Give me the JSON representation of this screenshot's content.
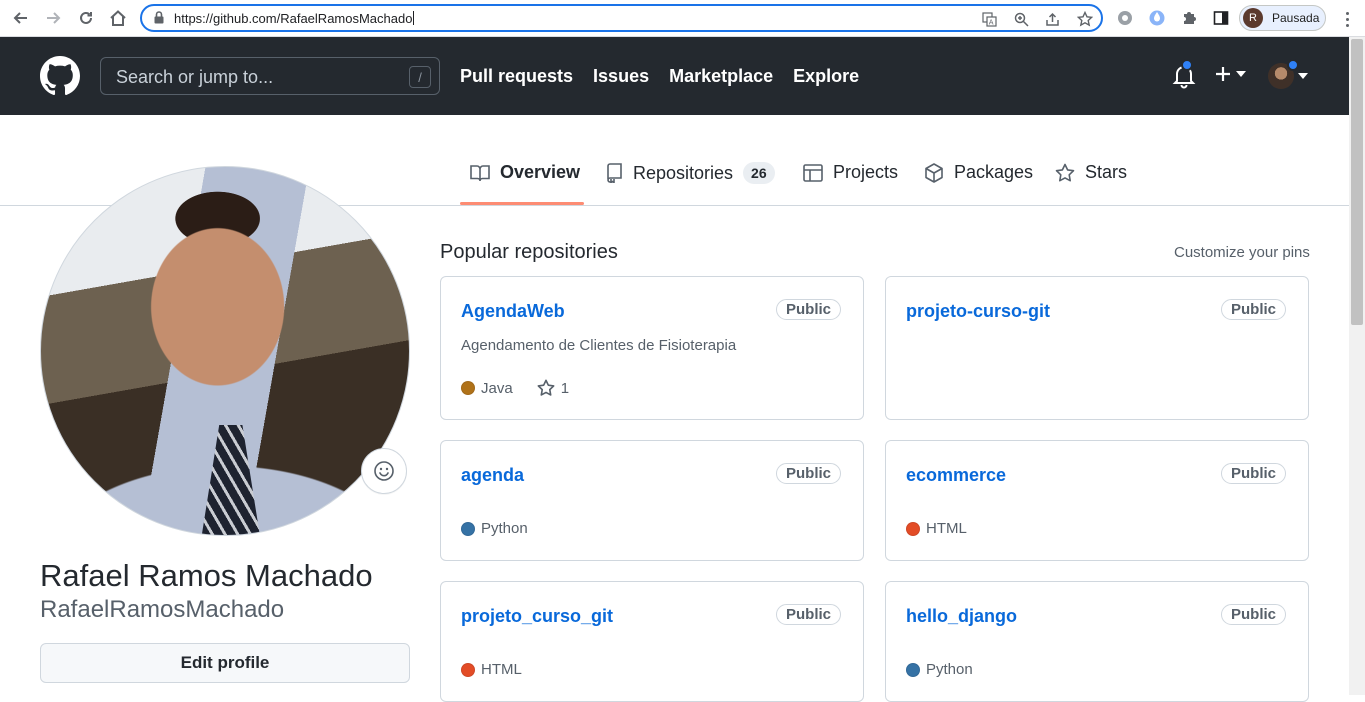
{
  "browser": {
    "url": "https://github.com/RafaelRamosMachado",
    "profile_initial": "R",
    "profile_status": "Pausada"
  },
  "header": {
    "search_placeholder": "Search or jump to...",
    "search_shortcut": "/",
    "nav": [
      "Pull requests",
      "Issues",
      "Marketplace",
      "Explore"
    ]
  },
  "tabs": [
    {
      "label": "Overview",
      "icon": "book-icon",
      "selected": true
    },
    {
      "label": "Repositories",
      "icon": "repo-icon",
      "count": "26"
    },
    {
      "label": "Projects",
      "icon": "table-icon"
    },
    {
      "label": "Packages",
      "icon": "package-icon"
    },
    {
      "label": "Stars",
      "icon": "star-icon"
    }
  ],
  "profile": {
    "full_name": "Rafael Ramos Machado",
    "username": "RafaelRamosMachado",
    "edit_label": "Edit profile"
  },
  "popular": {
    "title": "Popular repositories",
    "customize_label": "Customize your pins",
    "repos": [
      {
        "name": "AgendaWeb",
        "visibility": "Public",
        "description": "Agendamento de Clientes de Fisioterapia",
        "language": "Java",
        "lang_color": "#b07219",
        "stars": "1"
      },
      {
        "name": "projeto-curso-git",
        "visibility": "Public"
      },
      {
        "name": "agenda",
        "visibility": "Public",
        "language": "Python",
        "lang_color": "#3572a5"
      },
      {
        "name": "ecommerce",
        "visibility": "Public",
        "language": "HTML",
        "lang_color": "#e34c26"
      },
      {
        "name": "projeto_curso_git",
        "visibility": "Public",
        "language": "HTML",
        "lang_color": "#e34c26"
      },
      {
        "name": "hello_django",
        "visibility": "Public",
        "language": "Python",
        "lang_color": "#3572a5"
      }
    ]
  },
  "colors": {
    "header_bg": "#24292f",
    "link": "#0969da",
    "tab_underline": "#fd8c73"
  }
}
